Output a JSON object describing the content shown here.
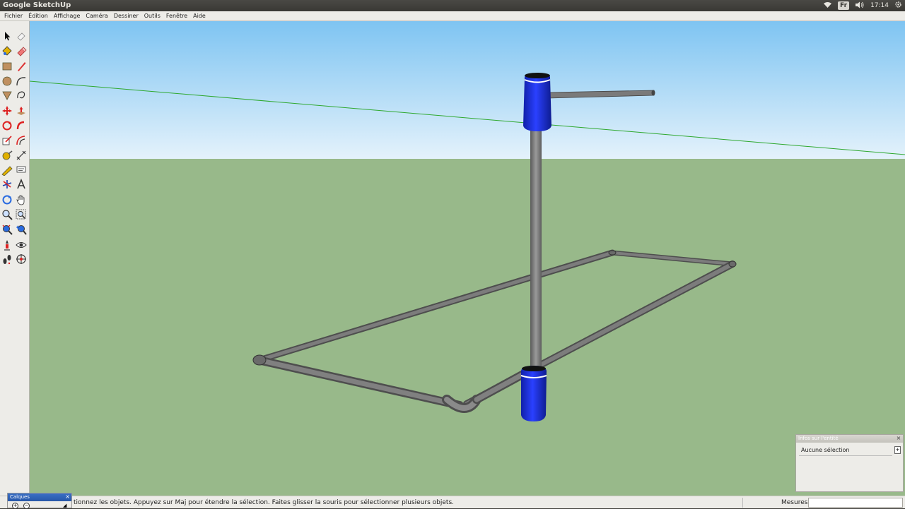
{
  "app": {
    "title": "Google SketchUp"
  },
  "system_tray": {
    "keyboard_layout": "Fr",
    "time": "17:14"
  },
  "menubar": {
    "items": [
      {
        "label": "Fichier"
      },
      {
        "label": "Édition"
      },
      {
        "label": "Affichage"
      },
      {
        "label": "Caméra"
      },
      {
        "label": "Dessiner"
      },
      {
        "label": "Outils"
      },
      {
        "label": "Fenêtre"
      },
      {
        "label": "Aide"
      }
    ]
  },
  "toolbar": {
    "tools": [
      "select-tool-icon",
      "eraser-tool-icon",
      "paint-bucket-tool-icon",
      "erase-tool-icon",
      "rectangle-tool-icon",
      "pencil-tool-icon",
      "circle-tool-icon",
      "arc-tool-icon",
      "polygon-tool-icon",
      "freehand-tool-icon",
      "move-tool-icon",
      "push-pull-tool-icon",
      "rotate-tool-icon",
      "follow-me-tool-icon",
      "scale-tool-icon",
      "offset-tool-icon",
      "tape-measure-tool-icon",
      "dimension-tool-icon",
      "protractor-tool-icon",
      "text-tool-icon",
      "axes-tool-icon",
      "3d-text-tool-icon",
      "orbit-tool-icon",
      "pan-tool-icon",
      "zoom-tool-icon",
      "zoom-window-tool-icon",
      "zoom-extents-tool-icon",
      "previous-view-tool-icon",
      "position-camera-tool-icon",
      "look-around-tool-icon",
      "walk-tool-icon",
      "section-plane-tool-icon"
    ]
  },
  "colors": {
    "sky_top": "#7ec4f2",
    "sky_bottom": "#e4f2fb",
    "ground": "#98b98a",
    "pipe": "#7a7a7a",
    "barrel": "#1a2fe0",
    "axis_green": "#2ea82e"
  },
  "status_bar": {
    "text": "tionnez les objets. Appuyez sur Maj pour étendre la sélection. Faites glisser la souris pour sélectionner plusieurs objets.",
    "measures_label": "Mesures",
    "measures_value": ""
  },
  "entity_info": {
    "title": "Infos sur l'entité",
    "selection": "Aucune sélection"
  },
  "layers_panel": {
    "title": "Calques"
  }
}
